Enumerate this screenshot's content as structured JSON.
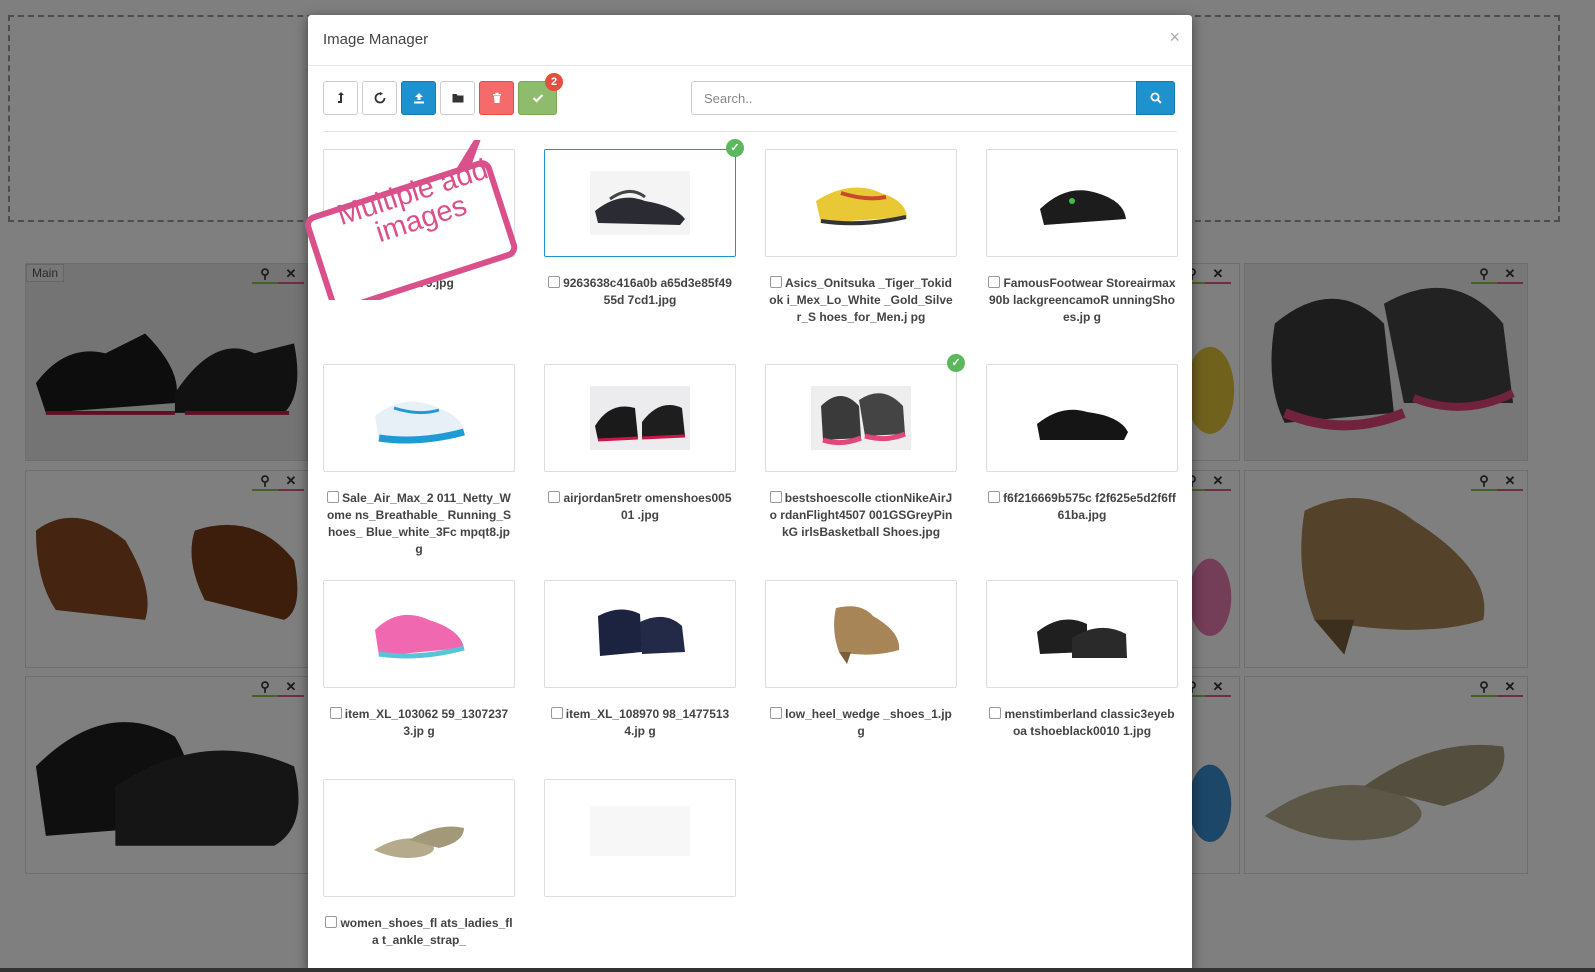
{
  "background": {
    "main_badge": "Main"
  },
  "modal": {
    "title": "Image Manager",
    "close_symbol": "×",
    "selected_count": "2",
    "search": {
      "placeholder": "Search.."
    },
    "toolbar": {
      "parent": "level-up-icon",
      "refresh": "refresh-icon",
      "upload": "upload-icon",
      "folder": "folder-icon",
      "delete": "trash-icon",
      "select": "check-icon"
    },
    "callout": {
      "text": "Multiple add images",
      "color": "#d9508a"
    },
    "images": [
      {
        "name": "13179.jpg",
        "selected": false
      },
      {
        "name": "9263638c416a0b a65d3e85f4955d 7cd1.jpg",
        "selected": true
      },
      {
        "name": "Asics_Onitsuka _Tiger_Tokidok i_Mex_Lo_White _Gold_Silver_S hoes_for_Men.j pg",
        "selected": false
      },
      {
        "name": "FamousFootwear Storeairmax90b lackgreencamoR unningShoes.jp g",
        "selected": false
      },
      {
        "name": "Sale_Air_Max_2 011_Netty_Wome ns_Breathable_ Running_Shoes_ Blue_white_3Fc mpqt8.jpg",
        "selected": false
      },
      {
        "name": "airjordan5retr omenshoes00501 .jpg",
        "selected": false
      },
      {
        "name": "bestshoescolle ctionNikeAirJo rdanFlight4507 001GSGreyPinkG irlsBasketball Shoes.jpg",
        "selected": true
      },
      {
        "name": "f6f216669b575c f2f625e5d2f6ff 61ba.jpg",
        "selected": false
      },
      {
        "name": "item_XL_103062 59_13072373.jp g",
        "selected": false
      },
      {
        "name": "item_XL_108970 98_14775134.jp g",
        "selected": false
      },
      {
        "name": "low_heel_wedge _shoes_1.jpg",
        "selected": false
      },
      {
        "name": "menstimberland classic3eyeboa tshoeblack0010 1.jpg",
        "selected": false
      },
      {
        "name": "women_shoes_fl ats_ladies_fla t_ankle_strap_",
        "selected": false
      },
      {
        "name": "",
        "selected": false
      }
    ]
  },
  "colors": {
    "primary": "#1e91cf",
    "danger": "#f56b6b",
    "success": "#8fbb6c",
    "badge": "#e3503e",
    "check": "#5cb85c"
  }
}
